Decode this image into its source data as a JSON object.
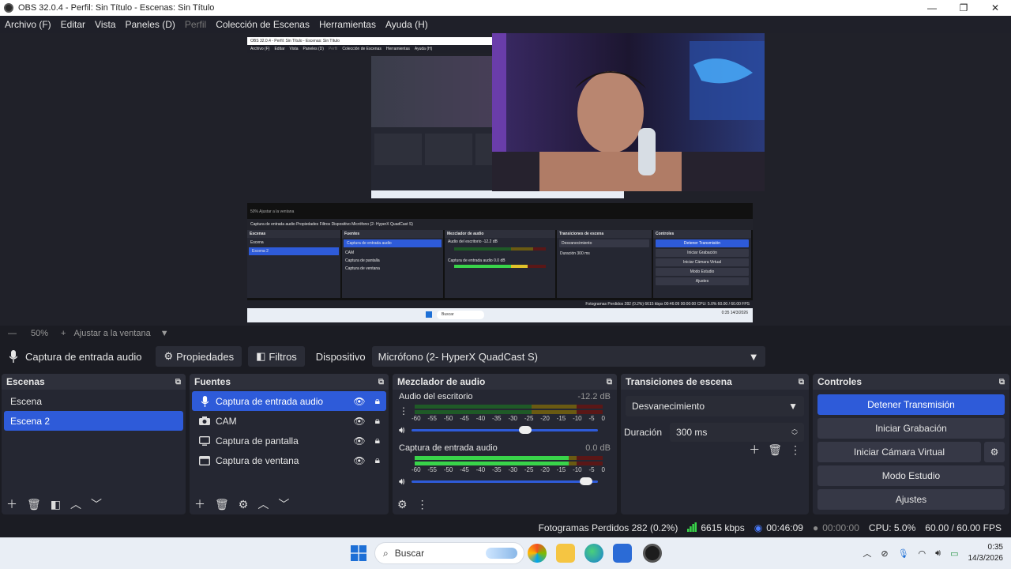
{
  "window": {
    "title": "OBS 32.0.4 - Perfil: Sin Título - Escenas: Sin Título",
    "minimize": "—",
    "maximize": "❐",
    "close": "✕"
  },
  "menu": [
    {
      "label": "Archivo (F)",
      "enabled": true
    },
    {
      "label": "Editar",
      "enabled": true
    },
    {
      "label": "Vista",
      "enabled": true
    },
    {
      "label": "Paneles (D)",
      "enabled": true
    },
    {
      "label": "Perfil",
      "enabled": false
    },
    {
      "label": "Colección de Escenas",
      "enabled": true
    },
    {
      "label": "Herramientas",
      "enabled": true
    },
    {
      "label": "Ayuda (H)",
      "enabled": true
    }
  ],
  "zoom": {
    "minus": "—",
    "value": "50%",
    "plus": "+",
    "fit_label": "Ajustar a la ventana"
  },
  "source_toolbar": {
    "source_name": "Captura de entrada audio",
    "properties_label": "Propiedades",
    "filters_label": "Filtros",
    "device_label": "Dispositivo",
    "device_value": "Micrófono (2- HyperX QuadCast S)"
  },
  "scenes": {
    "title": "Escenas",
    "items": [
      {
        "label": "Escena",
        "active": false
      },
      {
        "label": "Escena 2",
        "active": true
      }
    ]
  },
  "sources": {
    "title": "Fuentes",
    "items": [
      {
        "label": "Captura de entrada audio",
        "icon": "mic-icon",
        "active": true
      },
      {
        "label": "CAM",
        "icon": "camera-icon",
        "active": false
      },
      {
        "label": "Captura de pantalla",
        "icon": "monitor-icon",
        "active": false
      },
      {
        "label": "Captura de ventana",
        "icon": "window-icon",
        "active": false
      }
    ]
  },
  "mixer": {
    "title": "Mezclador de audio",
    "ticks": [
      "-60",
      "-55",
      "-50",
      "-45",
      "-40",
      "-35",
      "-30",
      "-25",
      "-20",
      "-15",
      "-10",
      "-5",
      "0"
    ],
    "channels": [
      {
        "name": "Audio del escritorio",
        "db": "-12.2 dB",
        "level": 0.0,
        "volume": 0.62
      },
      {
        "name": "Captura de entrada audio",
        "db": "0.0 dB",
        "level": 0.82,
        "volume": 0.97
      }
    ]
  },
  "transitions": {
    "title": "Transiciones de escena",
    "selected": "Desvanecimiento",
    "duration_label": "Duración",
    "duration_value": "300 ms"
  },
  "controls": {
    "title": "Controles",
    "stop_stream": "Detener Transmisión",
    "start_recording": "Iniciar Grabación",
    "start_virtual_cam": "Iniciar Cámara Virtual",
    "studio_mode": "Modo Estudio",
    "settings": "Ajustes"
  },
  "status": {
    "dropped_frames": "Fotogramas Perdidos 282 (0.2%)",
    "bitrate": "6615 kbps",
    "stream_time": "00:46:09",
    "rec_time": "00:00:00",
    "cpu": "CPU: 5.0%",
    "fps": "60.00 / 60.00 FPS"
  },
  "taskbar": {
    "search_placeholder": "Buscar",
    "time": "0:35",
    "date": "14/3/2026"
  },
  "mini": {
    "title": "OBS 32.0.4 - Perfil: Sin Título - Escenas: Sin Título",
    "menu": [
      "Archivo (F)",
      "Editar",
      "Vista",
      "Paneles (D)",
      "Perfil",
      "Colección de Escenas",
      "Herramientas",
      "Ayuda (H)"
    ],
    "zoom": "50%   Ajustar a la ventana",
    "src": "Captura de entrada audio    Propiedades    Filtros    Dispositivo    Micrófono (2- HyperX QuadCast S)",
    "scenes_title": "Escenas",
    "scene_a": "Escena",
    "scene_b": "Escena 2",
    "sources_title": "Fuentes",
    "src_a": "Captura de entrada audio",
    "src_b": "CAM",
    "src_c": "Captura de pantalla",
    "src_d": "Captura de ventana",
    "mixer_title": "Mezclador de audio",
    "mix_a": "Audio del escritorio   -12.2 dB",
    "mix_b": "Captura de entrada audio   0.0 dB",
    "trans_title": "Transiciones de escena",
    "trans_sel": "Desvanecimiento",
    "trans_dur": "Duración   300 ms",
    "ctrl_title": "Controles",
    "ctrl_a": "Detener Transmisión",
    "ctrl_b": "Iniciar Grabación",
    "ctrl_c": "Iniciar Cámara Virtual",
    "ctrl_d": "Modo Estudio",
    "ctrl_e": "Ajustes",
    "status": "Fotogramas Perdidos 282 (0.2%)   6615 kbps   00:46:09   00:00:00   CPU: 5.0%   60.00 / 60.00 FPS",
    "search": "Buscar",
    "clock": "0:35 14/3/2026"
  },
  "colors": {
    "accent": "#2e5bd9",
    "panel": "#252732",
    "meter_green": "#39d44a"
  }
}
